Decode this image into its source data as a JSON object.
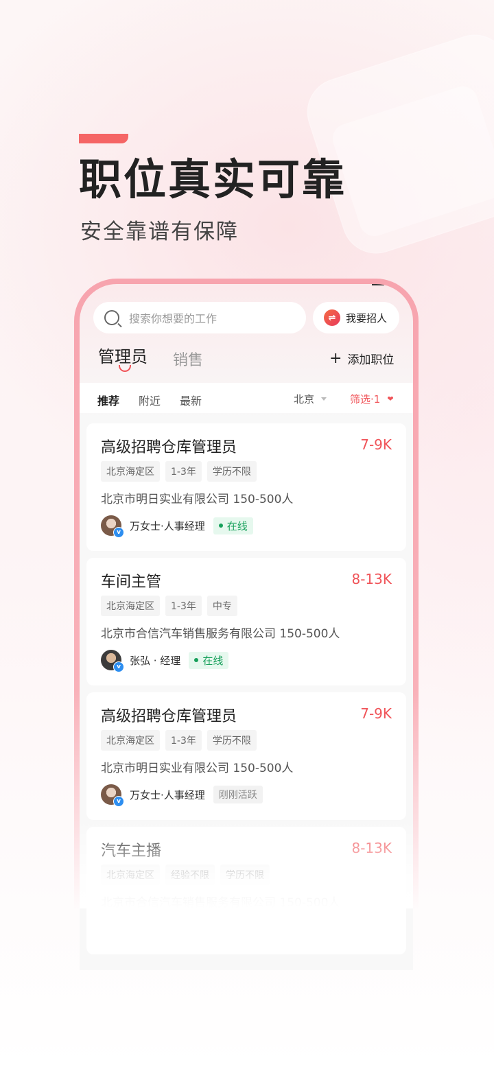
{
  "promo": {
    "headline": "职位真实可靠",
    "subline": "安全靠谱有保障"
  },
  "app": {
    "search_placeholder": "搜索你想要的工作",
    "recruit_label": "我要招人",
    "tabs": [
      "管理员",
      "销售"
    ],
    "add_job_label": "添加职位",
    "filters": [
      "推荐",
      "附近",
      "最新"
    ],
    "city": "北京",
    "filter_label": "筛选·1"
  },
  "jobs": [
    {
      "title": "高级招聘仓库管理员",
      "salary": "7-9K",
      "tags": [
        "北京海定区",
        "1-3年",
        "学历不限"
      ],
      "company": "北京市明日实业有限公司  150-500人",
      "recruiter": "万女士·人事经理",
      "status": "在线"
    },
    {
      "title": "车间主管",
      "salary": "8-13K",
      "tags": [
        "北京海定区",
        "1-3年",
        "中专"
      ],
      "company": "北京市合信汽车销售服务有限公司  150-500人",
      "recruiter": "张弘 · 经理",
      "status": "在线"
    },
    {
      "title": "高级招聘仓库管理员",
      "salary": "7-9K",
      "tags": [
        "北京海定区",
        "1-3年",
        "学历不限"
      ],
      "company": "北京市明日实业有限公司  150-500人",
      "recruiter": "万女士·人事经理",
      "status": "刚刚活跃"
    },
    {
      "title": "汽车主播",
      "salary": "8-13K",
      "tags": [
        "北京海定区",
        "经验不限",
        "学历不限"
      ],
      "company": "北京市合信汽车销售服务有限公司  150-500人"
    }
  ],
  "colors": {
    "accent": "#f05459",
    "online": "#16a05a",
    "verify": "#2d8ef0"
  }
}
